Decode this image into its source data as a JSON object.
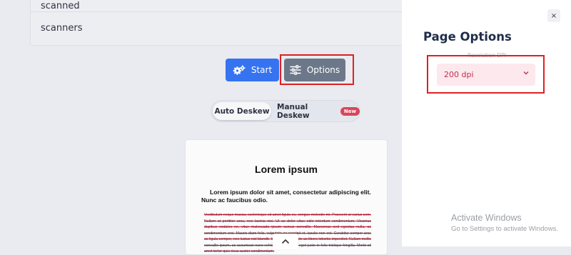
{
  "list": {
    "items": [
      "scanned",
      "scanners"
    ]
  },
  "actions": {
    "start_label": "Start",
    "options_label": "Options"
  },
  "deskew": {
    "auto_label": "Auto Deskew",
    "manual_label": "Manual Deskew",
    "new_badge": "New"
  },
  "document": {
    "title": "Lorem ipsum",
    "lead": "Lorem ipsum dolor sit amet, consectetur adipiscing elit. Nunc ac faucibus odio.",
    "body": "Vestibulum neque massa, scelerisque sit amet ligula eu, congue molestie mi. Praesent ut varius sem. Nullam at porttitor arcu, nec lacinia nisi. Ut ac dolor vitae odio interdum condimentum. Vivamus dapibus sodales ex, vitae malesuada ipsum cursus convallis. Maecenas sed egestas nulla, ac condimentum orci. Mauris diam felis, vulputate ac suscipit et, iaculis non est. Curabitur semper arcu ac ligula semper, nec luctus nisl blandit. Integer lacinia ante ac libero lobortis imperdiet. Nullam mollis convallis ipsum, ac accumsan nunc vehicula vitae. Nulla eget justo in felis tristique fringilla. Morbi sit amet tortor quis risus auctor condimentum."
  },
  "panel": {
    "title": "Page Options",
    "close_glyph": "×",
    "resolution_label": "Resolution DPI",
    "resolution_value": "200 dpi"
  },
  "windows": {
    "activate_title": "Activate Windows",
    "activate_text": "Go to Settings to activate Windows."
  },
  "colors": {
    "primary": "#3573f0",
    "secondary": "#6c7889",
    "highlight": "#e02020",
    "badge": "#d8455b",
    "select_bg": "#fde8ed",
    "select_text": "#c0304d"
  },
  "icons": {
    "start": "gears-icon",
    "options": "sliders-icon",
    "scroll": "chevron-up-icon",
    "select": "chevron-down-icon",
    "close": "close-icon"
  }
}
